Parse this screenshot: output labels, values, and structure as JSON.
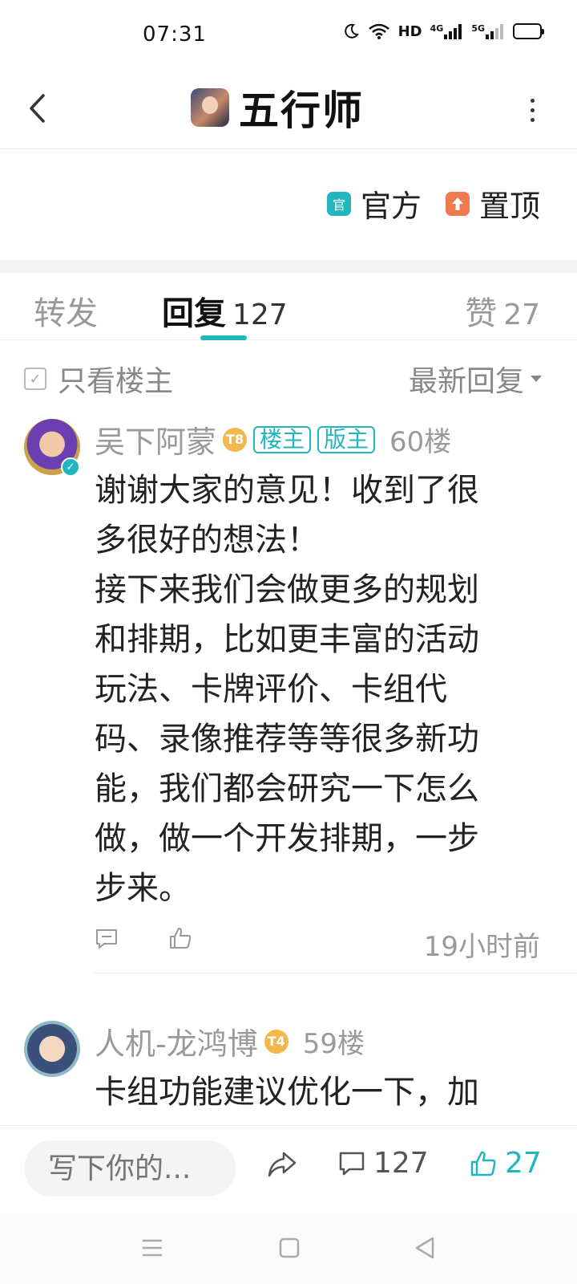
{
  "status_bar": {
    "time": "07:31",
    "icons": [
      "moon-icon",
      "wifi-icon",
      "hd-icon",
      "4g-signal-icon",
      "5g-signal-icon",
      "battery-icon"
    ],
    "hd_label": "HD",
    "net_4g": "4G",
    "net_5g": "5G",
    "battery_level": 0.9
  },
  "header": {
    "title": "五行师",
    "back_icon": "chevron-left-icon",
    "more_icon": "more-vertical-icon"
  },
  "tags": {
    "official_icon_text": "官",
    "official_label": "官方",
    "pinned_label": "置顶"
  },
  "tabs": {
    "forward_label": "转发",
    "reply_label": "回复",
    "reply_count": "127",
    "like_label": "赞",
    "like_count": "27"
  },
  "filter": {
    "only_op_label": "只看楼主",
    "sort_label": "最新回复"
  },
  "posts": [
    {
      "username": "吴下阿蒙",
      "level": "T8",
      "badges": [
        "楼主",
        "版主"
      ],
      "floor": "60楼",
      "verified": true,
      "content": "谢谢大家的意见！收到了很\n多很好的想法！\n接下来我们会做更多的规划\n和排期，比如更丰富的活动\n玩法、卡牌评价、卡组代\n码、录像推荐等等很多新功\n能，我们都会研究一下怎么\n做，做一个开发排期，一步\n步来。",
      "time": "19小时前"
    },
    {
      "username": "人机-龙鸿博",
      "level": "T4",
      "floor": "59楼",
      "content": "卡组功能建议优化一下，加"
    }
  ],
  "bottom_bar": {
    "input_placeholder": "写下你的...",
    "comment_count": "127",
    "like_count": "27"
  },
  "colors": {
    "accent": "#1fb6c1",
    "pinned": "#ef7a4f",
    "level_badge": "#f2b84b",
    "muted_text": "#9a9a9a"
  }
}
